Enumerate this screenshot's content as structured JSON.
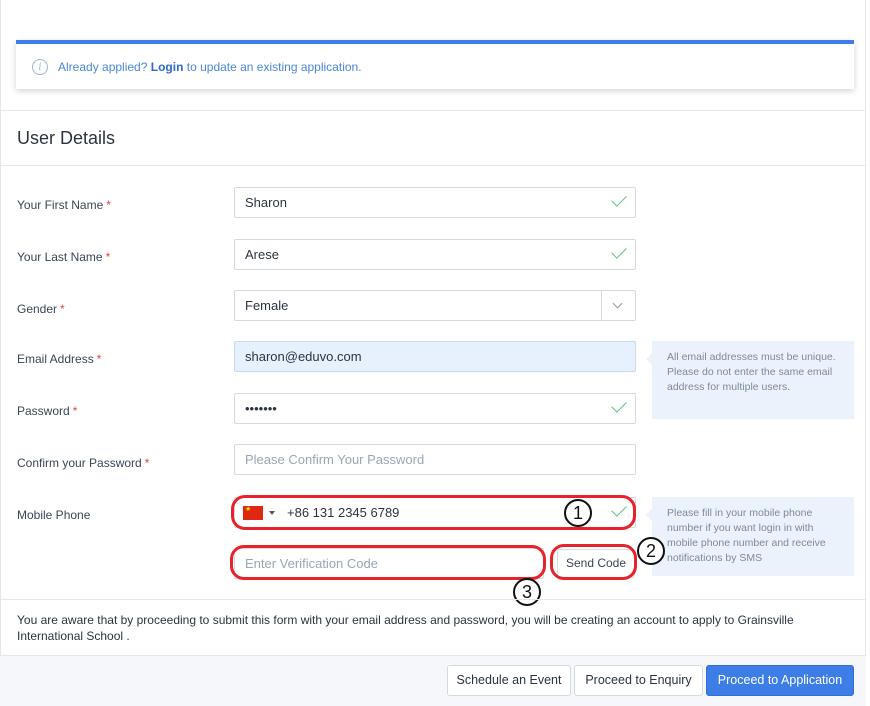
{
  "banner": {
    "prefix": "Already applied?",
    "link": "Login",
    "suffix": "to update an existing application."
  },
  "section": {
    "title": "User Details"
  },
  "fields": {
    "first_name": {
      "label": "Your First Name",
      "value": "Sharon",
      "required": "*"
    },
    "last_name": {
      "label": "Your Last Name",
      "value": "Arese",
      "required": "*"
    },
    "gender": {
      "label": "Gender",
      "value": "Female",
      "required": "*"
    },
    "email": {
      "label": "Email Address",
      "value": "sharon@eduvo.com",
      "required": "*"
    },
    "password": {
      "label": "Password",
      "value": "•••••••",
      "required": "*"
    },
    "confirm_password": {
      "label": "Confirm your Password",
      "placeholder": "Please Confirm Your Password",
      "required": "*"
    },
    "mobile": {
      "label": "Mobile Phone",
      "value": "+86 131 2345 6789",
      "country_flag": "china-flag"
    },
    "verification": {
      "placeholder": "Enter Verification Code"
    }
  },
  "hints": {
    "email": "All email addresses must be unique. Please do not enter the same email address for multiple users.",
    "mobile": "Please fill in your mobile phone number if you want login in with mobile phone number and receive notifications by SMS"
  },
  "send_code": "Send Code",
  "annotations": [
    "1",
    "2",
    "3"
  ],
  "consent": "You are aware that by proceeding to submit this form with your email address and password, you will be creating an account to apply to Grainsville International School .",
  "footer": {
    "schedule": "Schedule an Event",
    "enquiry": "Proceed to Enquiry",
    "application": "Proceed to Application"
  },
  "colors": {
    "primary": "#3c7de6",
    "annotation_ring": "#e8222a",
    "valid": "#5fc27e",
    "required": "#e04444"
  }
}
